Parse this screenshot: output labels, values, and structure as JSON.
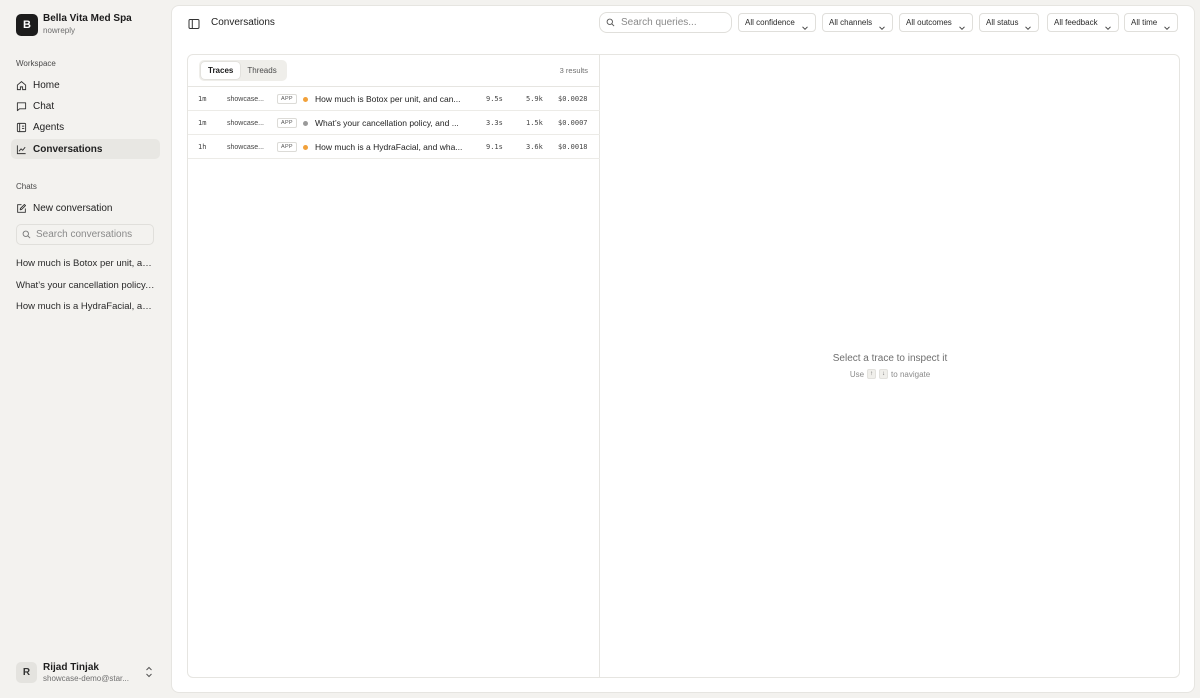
{
  "org": {
    "initial": "B",
    "name": "Bella Vita Med Spa",
    "subtitle": "nowreply"
  },
  "sidebar": {
    "workspace_label": "Workspace",
    "nav": [
      {
        "label": "Home",
        "icon": "home-icon"
      },
      {
        "label": "Chat",
        "icon": "chat-icon"
      },
      {
        "label": "Agents",
        "icon": "agents-icon"
      },
      {
        "label": "Conversations",
        "icon": "chart-line-icon",
        "active": true
      }
    ],
    "chats_label": "Chats",
    "new_conversation_label": "New conversation",
    "search_placeholder": "Search conversations",
    "chats": [
      "How much is Botox per unit, and can...",
      "What’s your cancellation policy, and...",
      "How much is a HydraFacial, and what..."
    ]
  },
  "user": {
    "initial": "R",
    "name": "Rijad Tinjak",
    "email": "showcase-demo@star..."
  },
  "header": {
    "title": "Conversations",
    "search_placeholder": "Search queries...",
    "filters": [
      "All confidence",
      "All channels",
      "All outcomes",
      "All status",
      "All feedback",
      "All time"
    ]
  },
  "list": {
    "tabs": [
      "Traces",
      "Threads"
    ],
    "active_tab": "Traces",
    "results_label": "3 results",
    "rows": [
      {
        "time": "1m",
        "source": "showcase...",
        "badge": "APP",
        "query": "How much is Botox per unit, and can...",
        "duration": "9.5s",
        "tokens": "5.9k",
        "cost": "$0.0028"
      },
      {
        "time": "1m",
        "source": "showcase...",
        "badge": "APP",
        "query": "What’s your cancellation policy, and ...",
        "duration": "3.3s",
        "tokens": "1.5k",
        "cost": "$0.0007"
      },
      {
        "time": "1h",
        "source": "showcase...",
        "badge": "APP",
        "query": "How much is a HydraFacial, and wha...",
        "duration": "9.1s",
        "tokens": "3.6k",
        "cost": "$0.0018"
      }
    ],
    "status_color": "#f2a13a"
  },
  "detail": {
    "empty_title": "Select a trace to inspect it",
    "hint_prefix": "Use",
    "hint_key_up": "↑",
    "hint_key_down": "↓",
    "hint_suffix": "to navigate"
  }
}
